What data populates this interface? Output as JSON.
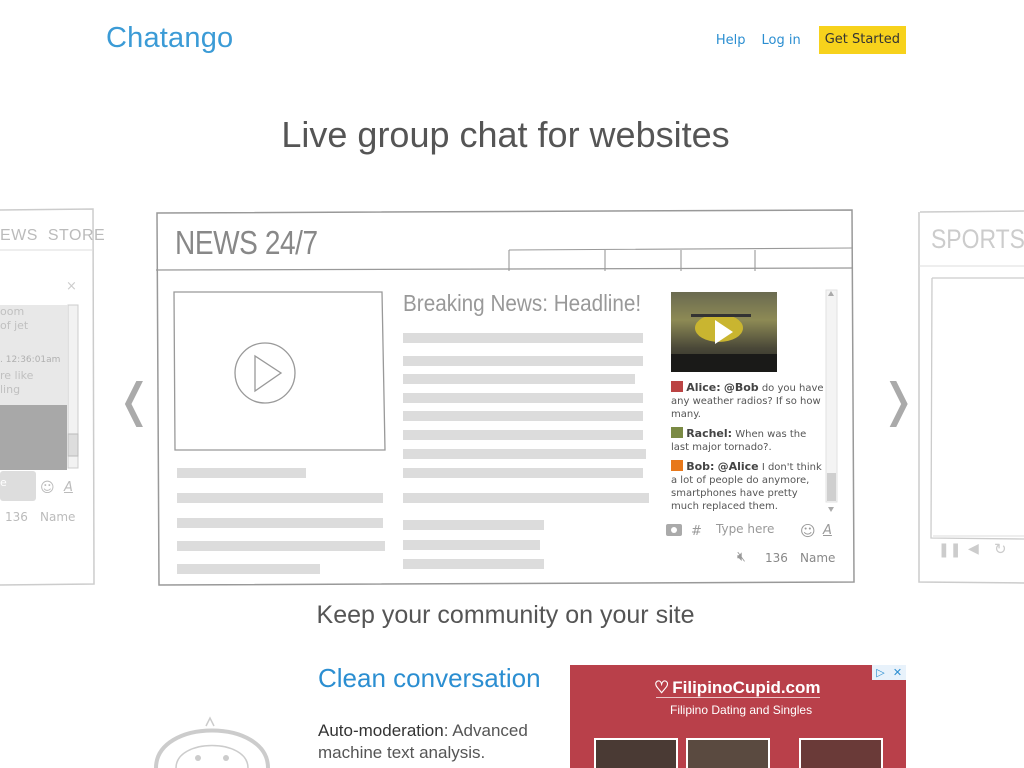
{
  "header": {
    "logo": "Chatango",
    "nav": {
      "help": "Help",
      "login": "Log in",
      "cta": "Get Started"
    }
  },
  "hero": {
    "headline": "Live group chat for websites"
  },
  "carousel": {
    "prev_arrow": "❬",
    "next_arrow": "❭",
    "left_panel": {
      "nav_text": "EWS  STORE",
      "close": "×",
      "lines": [
        "oom",
        "of jet",
        ". 12:36:01am",
        "re like",
        "ling"
      ],
      "input_hint": "e",
      "count": "136",
      "name": "Name",
      "font_btn": "A"
    },
    "main_panel": {
      "site_title": "NEWS 24/7",
      "article_headline": "Breaking News: Headline!",
      "chat": {
        "messages": [
          {
            "name": "Alice:",
            "mention": "@Bob",
            "text": "do you have any weather radios? If so how many."
          },
          {
            "name": "Rachel:",
            "mention": "",
            "text": "When was the last major tornado?."
          },
          {
            "name": "Bob:",
            "mention": "@Alice",
            "text": "I don't think a lot of people do anymore, smartphones have pretty much replaced them."
          }
        ],
        "hash": "#",
        "placeholder": "Type here",
        "font_btn": "A",
        "count": "136",
        "name": "Name"
      }
    },
    "right_panel": {
      "site_title": "SPORTS"
    }
  },
  "community": {
    "headline": "Keep your community on your site"
  },
  "feature": {
    "title": "Clean conversation",
    "bold": "Auto-moderation",
    "text": ": Advanced machine text analysis."
  },
  "ad": {
    "brand": "FilipinoCupid.com",
    "tagline": "Filipino Dating and Singles",
    "adchoices": "▷",
    "close": "✕"
  },
  "colors": {
    "brand_blue": "#3b9bd6",
    "cta_yellow": "#f7d21c",
    "ad_red": "#b9404a"
  }
}
